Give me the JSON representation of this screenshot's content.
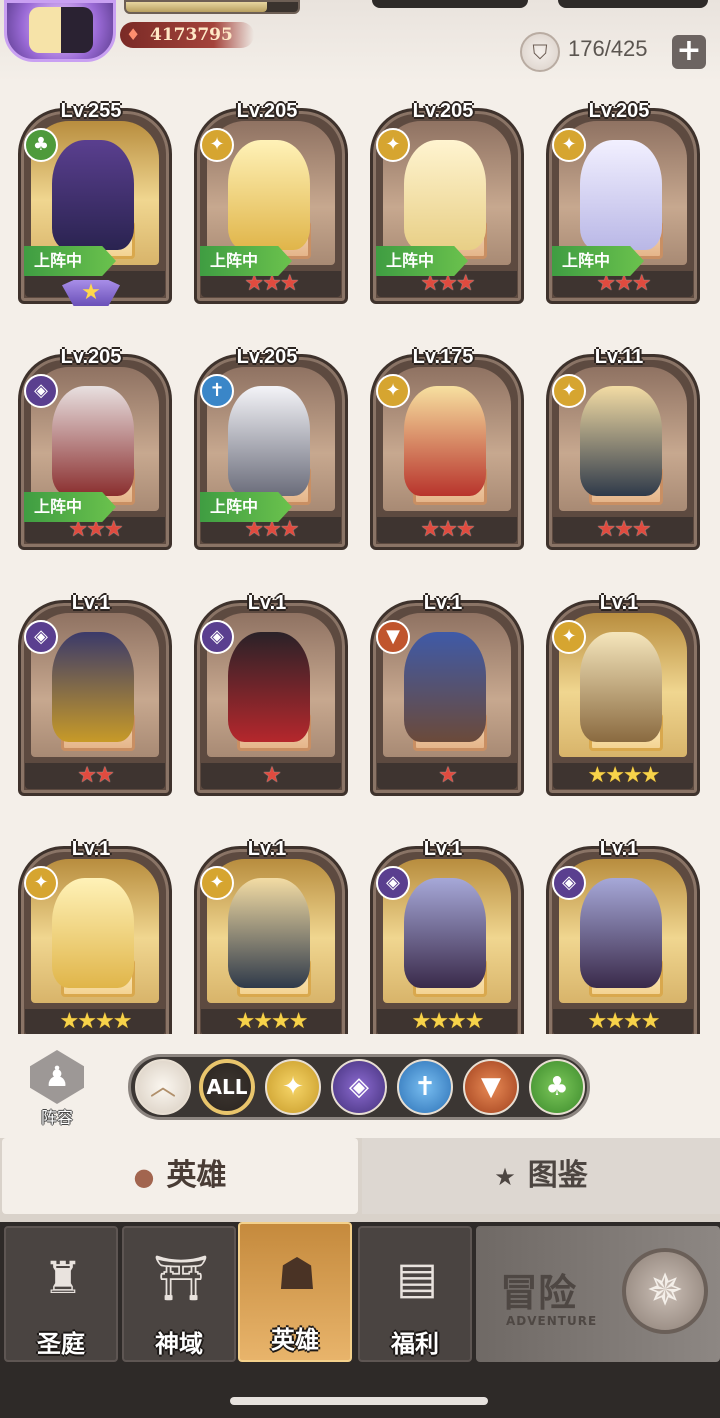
{
  "header": {
    "power_value": "4173795",
    "roster_count": "176/425",
    "add_label": "+"
  },
  "heroes": [
    {
      "level": "Lv.255",
      "faction": "nature",
      "deployed": true,
      "stars": 1,
      "star_color": "gold",
      "rank_badge": true
    },
    {
      "level": "Lv.205",
      "faction": "light",
      "deployed": true,
      "stars": 3,
      "star_color": "red"
    },
    {
      "level": "Lv.205",
      "faction": "light",
      "deployed": true,
      "stars": 3,
      "star_color": "red"
    },
    {
      "level": "Lv.205",
      "faction": "light",
      "deployed": true,
      "stars": 3,
      "star_color": "red"
    },
    {
      "level": "Lv.205",
      "faction": "dark",
      "deployed": true,
      "stars": 3,
      "star_color": "red"
    },
    {
      "level": "Lv.205",
      "faction": "holy",
      "deployed": true,
      "stars": 3,
      "star_color": "red"
    },
    {
      "level": "Lv.175",
      "faction": "light",
      "deployed": false,
      "stars": 3,
      "star_color": "red"
    },
    {
      "level": "Lv.11",
      "faction": "light",
      "deployed": false,
      "stars": 3,
      "star_color": "red"
    },
    {
      "level": "Lv.1",
      "faction": "dark",
      "deployed": false,
      "stars": 2,
      "star_color": "red"
    },
    {
      "level": "Lv.1",
      "faction": "dark",
      "deployed": false,
      "stars": 1,
      "star_color": "red"
    },
    {
      "level": "Lv.1",
      "faction": "beast",
      "deployed": false,
      "stars": 1,
      "star_color": "red"
    },
    {
      "level": "Lv.1",
      "faction": "light",
      "deployed": false,
      "stars": 4,
      "star_color": "gold"
    },
    {
      "level": "Lv.1",
      "faction": "light",
      "deployed": false,
      "stars": 4,
      "star_color": "gold"
    },
    {
      "level": "Lv.1",
      "faction": "light",
      "deployed": false,
      "stars": 4,
      "star_color": "gold"
    },
    {
      "level": "Lv.1",
      "faction": "dark",
      "deployed": false,
      "stars": 4,
      "star_color": "gold"
    },
    {
      "level": "Lv.1",
      "faction": "dark",
      "deployed": false,
      "stars": 4,
      "star_color": "gold"
    }
  ],
  "deployed_label": "上阵中",
  "filters": {
    "formation_label": "阵容",
    "all_label": "ALL",
    "items": [
      "collapse",
      "all",
      "light",
      "dark",
      "holy",
      "beast",
      "nature"
    ]
  },
  "tabs": {
    "heroes_label": "英雄",
    "codex_label": "图鉴"
  },
  "nav": {
    "items": [
      "圣庭",
      "神域",
      "英雄",
      "福利"
    ],
    "active": "英雄",
    "adventure_title": "冒险",
    "adventure_sub": "ADVENTURE"
  },
  "colors": {
    "star_red": "#e04b3f",
    "star_gold": "#f7d34a",
    "deploy_green": "#4caf45",
    "active_nav": "#d9a056"
  }
}
